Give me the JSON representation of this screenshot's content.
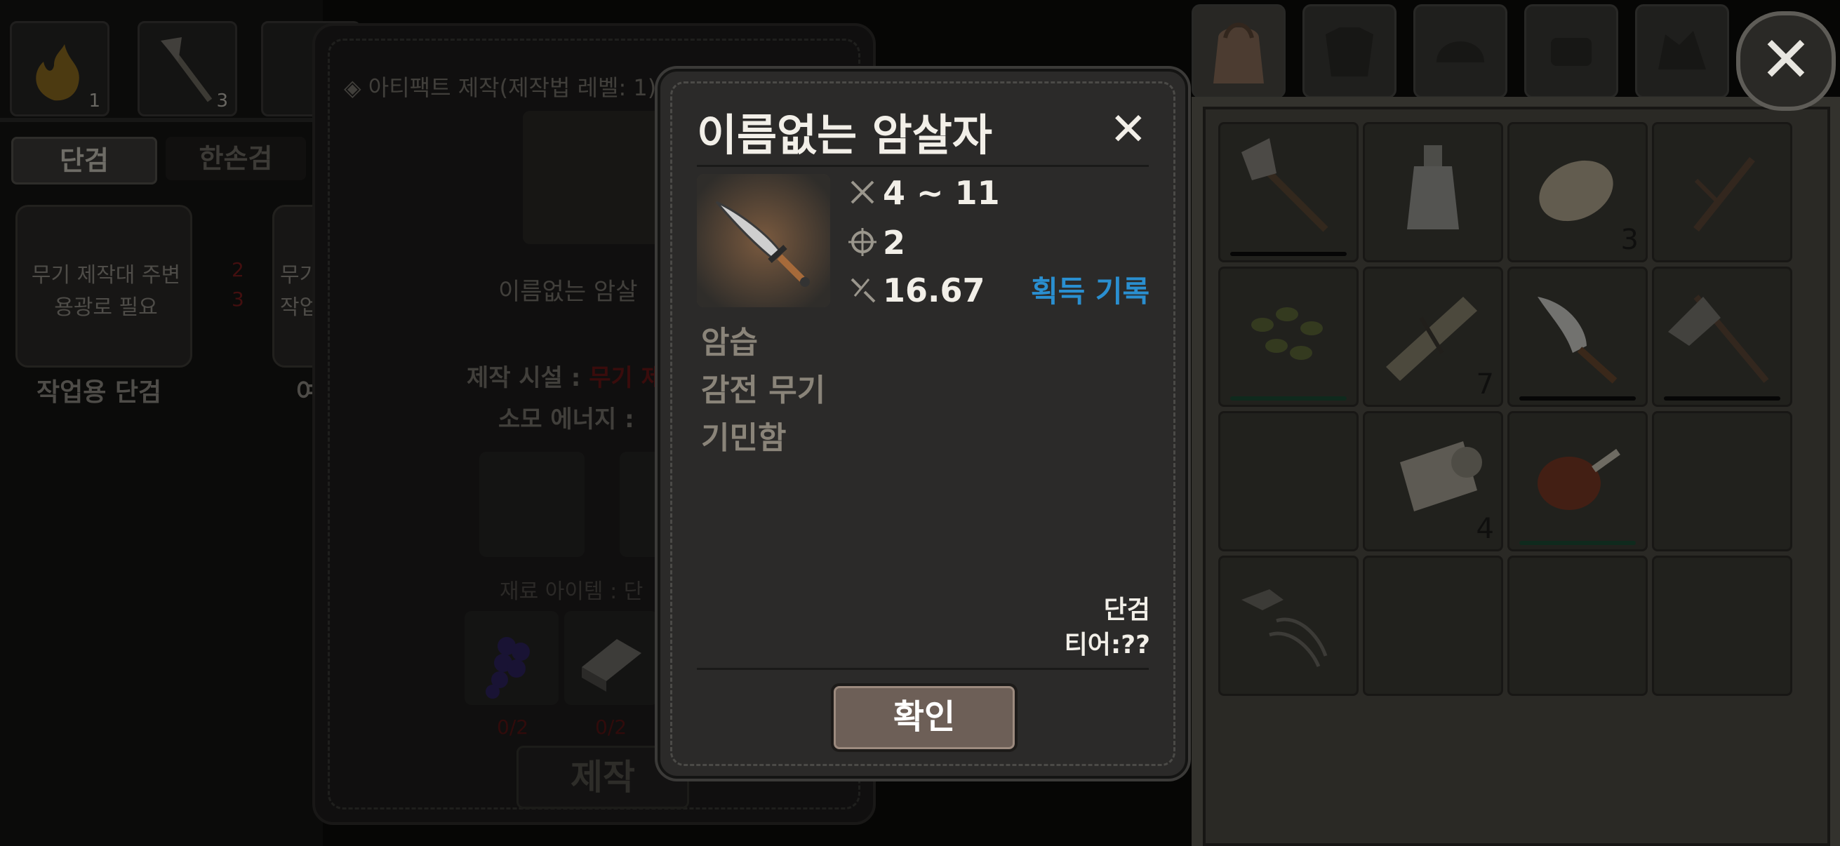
{
  "left_panel": {
    "slot_counts": [
      "1",
      "3"
    ],
    "tabs": [
      "단검",
      "한손검"
    ],
    "recipe_card_1": {
      "text": "무기 제작대 주변\n용광로 필요",
      "req_a": "2",
      "req_b": "3",
      "name": "작업용 단검"
    },
    "recipe_card_2": {
      "text": "무기\n작업",
      "name": "여"
    }
  },
  "craft_panel": {
    "header": "아티팩트 제작(제작법 레벨: 1)",
    "item_name": "이름없는 암살",
    "facility_label": "제작 시설 : ",
    "facility_value": "무기 제",
    "energy_label": "소모 에너지 : ",
    "materials_label": "재료 아이템 : 단",
    "material_counts": [
      "0/2",
      "0/2"
    ],
    "craft_button": "제작"
  },
  "modal": {
    "title": "이름없는 암살자",
    "close_glyph": "✕",
    "stats": {
      "damage": "4 ~ 11",
      "accuracy": "2",
      "durability": "16.67"
    },
    "acquisition_link": "획득 기록",
    "traits": [
      "암습",
      "감전 무기",
      "기민함"
    ],
    "weapon_type": "단검",
    "tier": "티어:??",
    "confirm_button": "확인"
  },
  "inventory": {
    "counts": [
      "3",
      "7",
      "4"
    ]
  },
  "close_button": "✕",
  "colors": {
    "accent_link": "#2a8fd0",
    "warning_red": "#b02020",
    "panel_bg": "#2b2a29",
    "inventory_bg": "#5d5b52"
  }
}
